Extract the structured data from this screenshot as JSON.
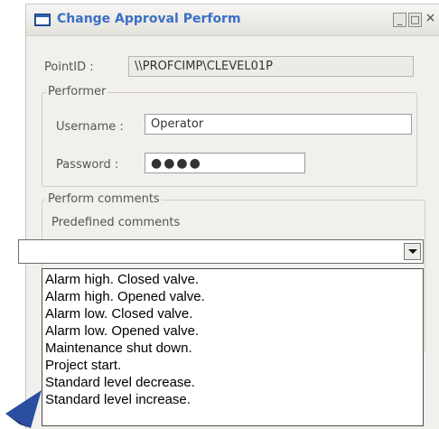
{
  "window": {
    "title": "Change Approval Perform",
    "controls": {
      "minimize": "_",
      "maximize": "□",
      "close": "×"
    }
  },
  "point": {
    "label": "PointID :",
    "value": "\\\\PROFCIMP\\CLEVEL01P"
  },
  "performer": {
    "legend": "Performer",
    "username_label": "Username :",
    "username_value": "Operator",
    "password_label": "Password :",
    "password_value": "●●●●"
  },
  "comments": {
    "legend": "Perform comments",
    "predefined_label": "Predefined comments",
    "selected_value": ""
  },
  "dropdown_options": [
    "Alarm high. Closed valve.",
    "Alarm high. Opened valve.",
    "Alarm low. Closed valve.",
    "Alarm low. Opened valve.",
    "Maintenance shut down.",
    "Project start.",
    "Standard level decrease.",
    "Standard level increase."
  ],
  "colors": {
    "title_text": "#3a6fc4",
    "window_bg": "#f1f0ed",
    "pointer": "#2b4fa0"
  },
  "icons": [
    "window-app-icon",
    "dropdown-arrow-icon",
    "pointer-arrow-icon"
  ]
}
